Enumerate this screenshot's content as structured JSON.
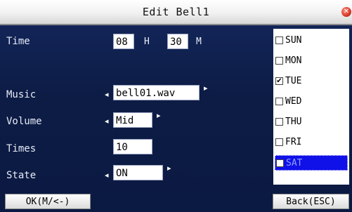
{
  "title": "Edit Bell1",
  "labels": {
    "time": "Time",
    "music": "Music",
    "volume": "Volume",
    "times": "Times",
    "state": "State"
  },
  "time": {
    "hour": "08",
    "hour_unit": "H",
    "minute": "30",
    "minute_unit": "M"
  },
  "music": "bell01.wav",
  "volume": "Mid",
  "times": "10",
  "state": "ON",
  "days": [
    {
      "name": "SUN",
      "checked": false,
      "selected": false
    },
    {
      "name": "MON",
      "checked": false,
      "selected": false
    },
    {
      "name": "TUE",
      "checked": true,
      "selected": false
    },
    {
      "name": "WED",
      "checked": false,
      "selected": false
    },
    {
      "name": "THU",
      "checked": false,
      "selected": false
    },
    {
      "name": "FRI",
      "checked": false,
      "selected": false
    },
    {
      "name": "SAT",
      "checked": false,
      "selected": true
    }
  ],
  "buttons": {
    "ok": "OK(M/<-)",
    "back": "Back(ESC)"
  }
}
